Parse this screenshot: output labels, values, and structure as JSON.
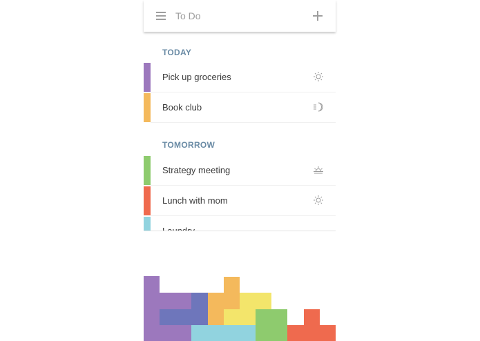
{
  "header": {
    "title": "To Do",
    "menu_icon": "hamburger-menu-icon",
    "add_icon": "plus-icon"
  },
  "sections": [
    {
      "heading": "TODAY",
      "tasks": [
        {
          "label": "Pick up groceries",
          "color": "#9c78bd",
          "time_icon": "sun-icon"
        },
        {
          "label": "Book club",
          "color": "#f4b95c",
          "time_icon": "moon-icon"
        }
      ]
    },
    {
      "heading": "TOMORROW",
      "tasks": [
        {
          "label": "Strategy meeting",
          "color": "#8ecb6e",
          "time_icon": "sunrise-icon"
        },
        {
          "label": "Lunch with mom",
          "color": "#ef6a4e",
          "time_icon": "sun-icon"
        },
        {
          "label": "Laundry",
          "color": "#91d3df",
          "time_icon": ""
        }
      ]
    }
  ],
  "colors": {
    "purple": "#9c78bd",
    "indigo": "#6e76bb",
    "orange": "#f4b95c",
    "yellow": "#f3e56b",
    "green": "#8ecb6e",
    "red": "#ef6a4e",
    "cyan": "#91d3df",
    "section_heading": "#6a8ba5"
  }
}
